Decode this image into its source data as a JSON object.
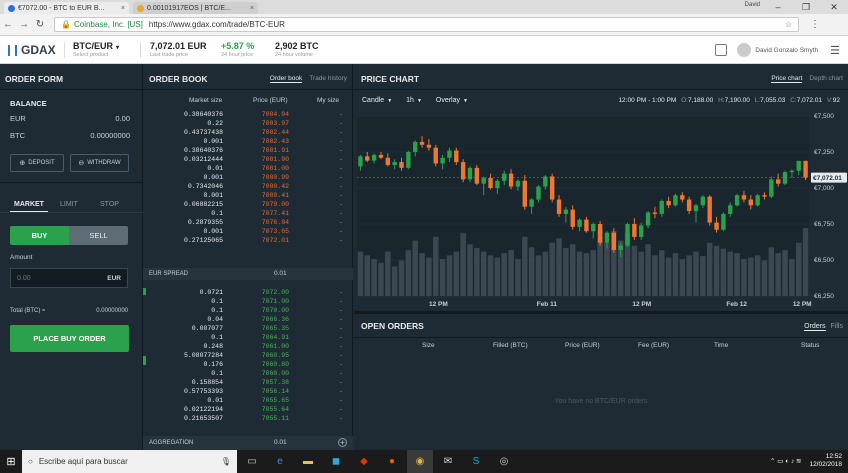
{
  "browser": {
    "tabs": [
      {
        "label": "€7072.00 - BTC to EUR B...",
        "active": true
      },
      {
        "label": "0.00101917EOS | BTC/E...",
        "active": false
      }
    ],
    "user_chip": "David",
    "controls": [
      "–",
      "❐",
      "✕"
    ],
    "secure_label": "Coinbase, Inc. [US]",
    "url": "https://www.gdax.com/trade/BTC-EUR"
  },
  "header": {
    "logo": "GDAX",
    "product": {
      "value": "BTC/EUR",
      "caption": "Select product"
    },
    "last_price": {
      "value": "7,072.01 EUR",
      "caption": "Last trade price"
    },
    "change": {
      "value": "+5.87 %",
      "caption": "24 hour price"
    },
    "volume": {
      "value": "2,902 BTC",
      "caption": "24 hour volume"
    },
    "user_name": "David Gonzalo Smyth"
  },
  "order_form": {
    "title": "ORDER FORM",
    "balance_title": "BALANCE",
    "balances": [
      {
        "currency": "EUR",
        "amount": "0.00"
      },
      {
        "currency": "BTC",
        "amount": "0.00000000"
      }
    ],
    "deposit_label": "DEPOSIT",
    "withdraw_label": "WITHDRAW",
    "tabs": [
      "MARKET",
      "LIMIT",
      "STOP"
    ],
    "buy_label": "BUY",
    "sell_label": "SELL",
    "amount_label": "Amount",
    "amount_placeholder": "0.00",
    "amount_currency": "EUR",
    "total_label": "Total (BTC) ≈",
    "total_value": "0.00000000",
    "place_label": "PLACE BUY ORDER"
  },
  "order_book": {
    "title": "ORDER BOOK",
    "tabs": [
      "Order book",
      "Trade history"
    ],
    "columns": [
      "Market size",
      "Price (EUR)",
      "My size"
    ],
    "asks": [
      {
        "size": "0.38640376",
        "price": "7084.04",
        "my": "-"
      },
      {
        "size": "0.22",
        "price": "7083.97",
        "my": "-"
      },
      {
        "size": "0.43737438",
        "price": "7082.44",
        "my": "-"
      },
      {
        "size": "0.001",
        "price": "7082.43",
        "my": "-"
      },
      {
        "size": "0.38640376",
        "price": "7081.91",
        "my": "-"
      },
      {
        "size": "0.03212444",
        "price": "7081.90",
        "my": "-"
      },
      {
        "size": "0.01",
        "price": "7081.00",
        "my": "-"
      },
      {
        "size": "0.001",
        "price": "7080.99",
        "my": "-"
      },
      {
        "size": "0.7342046",
        "price": "7080.42",
        "my": "-"
      },
      {
        "size": "0.001",
        "price": "7080.41",
        "my": "-"
      },
      {
        "size": "0.06882215",
        "price": "7079.00",
        "my": "-"
      },
      {
        "size": "0.1",
        "price": "7077.41",
        "my": "-"
      },
      {
        "size": "0.2879355",
        "price": "7076.84",
        "my": "-"
      },
      {
        "size": "0.001",
        "price": "7073.65",
        "my": "-"
      },
      {
        "size": "0.27125065",
        "price": "7072.01",
        "my": "-"
      }
    ],
    "spread_label": "EUR SPREAD",
    "spread_value": "0.01",
    "bids": [
      {
        "size": "0.0721",
        "price": "7072.00",
        "my": "-"
      },
      {
        "size": "0.1",
        "price": "7071.00",
        "my": "-"
      },
      {
        "size": "0.1",
        "price": "7070.00",
        "my": "-"
      },
      {
        "size": "0.04",
        "price": "7066.36",
        "my": "-"
      },
      {
        "size": "0.007077",
        "price": "7065.35",
        "my": "-"
      },
      {
        "size": "0.1",
        "price": "7064.91",
        "my": "-"
      },
      {
        "size": "0.248",
        "price": "7061.00",
        "my": "-"
      },
      {
        "size": "5.08077284",
        "price": "7060.95",
        "my": "-"
      },
      {
        "size": "0.176",
        "price": "7060.80",
        "my": "-"
      },
      {
        "size": "0.1",
        "price": "7060.00",
        "my": "-"
      },
      {
        "size": "0.158854",
        "price": "7057.38",
        "my": "-"
      },
      {
        "size": "0.57753393",
        "price": "7056.14",
        "my": "-"
      },
      {
        "size": "0.01",
        "price": "7055.65",
        "my": "-"
      },
      {
        "size": "0.02122194",
        "price": "7055.64",
        "my": "-"
      },
      {
        "size": "0.21653507",
        "price": "7055.11",
        "my": "-"
      }
    ],
    "aggregation_label": "AGGREGATION",
    "aggregation_value": "0.01"
  },
  "price_chart": {
    "title": "PRICE CHART",
    "tabs": [
      "Price chart",
      "Depth chart"
    ],
    "tools": [
      "Candle",
      "1h",
      "Overlay"
    ],
    "range": "12:00 PM - 1:00 PM",
    "ohlc": [
      {
        "k": "O:",
        "v": "7,188.00"
      },
      {
        "k": "H:",
        "v": "7,190.00"
      },
      {
        "k": "L:",
        "v": "7,055.03"
      },
      {
        "k": "C:",
        "v": "7,072.01"
      },
      {
        "k": "V:",
        "v": "92"
      }
    ],
    "colors": {
      "up": "#2aa14a",
      "down": "#f0772f",
      "volume": "#3b4852",
      "bg": "#1e2b34",
      "grid": "#2a3842"
    }
  },
  "chart_data": {
    "type": "candlestick",
    "title": "",
    "x_ticks": [
      "12 PM",
      "Feb 11",
      "12 PM",
      "Feb 12",
      "12 PM"
    ],
    "y_ticks": [
      "€7,500",
      "€7,250",
      "€7,000",
      "€6,750",
      "€6,500",
      "€6,250"
    ],
    "ylim": [
      6250,
      7500
    ],
    "current_price_label": "€7,072.01",
    "grid": true,
    "candles": [
      [
        7150,
        7230,
        7120,
        7220,
        60
      ],
      [
        7220,
        7250,
        7180,
        7190,
        55
      ],
      [
        7190,
        7240,
        7170,
        7230,
        50
      ],
      [
        7230,
        7250,
        7200,
        7210,
        45
      ],
      [
        7210,
        7240,
        7150,
        7160,
        60
      ],
      [
        7160,
        7200,
        7130,
        7180,
        40
      ],
      [
        7180,
        7210,
        7120,
        7140,
        48
      ],
      [
        7140,
        7260,
        7130,
        7250,
        62
      ],
      [
        7250,
        7330,
        7220,
        7320,
        75
      ],
      [
        7320,
        7360,
        7280,
        7300,
        58
      ],
      [
        7300,
        7340,
        7260,
        7280,
        52
      ],
      [
        7280,
        7300,
        7150,
        7170,
        80
      ],
      [
        7170,
        7230,
        7130,
        7210,
        50
      ],
      [
        7210,
        7280,
        7180,
        7260,
        55
      ],
      [
        7260,
        7280,
        7160,
        7180,
        60
      ],
      [
        7180,
        7200,
        7040,
        7060,
        85
      ],
      [
        7060,
        7150,
        7040,
        7140,
        70
      ],
      [
        7140,
        7160,
        7020,
        7030,
        65
      ],
      [
        7030,
        7080,
        6950,
        7070,
        60
      ],
      [
        7070,
        7100,
        6990,
        7000,
        55
      ],
      [
        7000,
        7060,
        6960,
        7050,
        52
      ],
      [
        7050,
        7120,
        7020,
        7100,
        58
      ],
      [
        7100,
        7130,
        6990,
        7010,
        62
      ],
      [
        7010,
        7060,
        6980,
        7050,
        50
      ],
      [
        7050,
        7090,
        6850,
        6870,
        80
      ],
      [
        6870,
        6930,
        6820,
        6920,
        66
      ],
      [
        6920,
        7020,
        6900,
        7010,
        55
      ],
      [
        7010,
        7090,
        6990,
        7080,
        60
      ],
      [
        7080,
        7100,
        6900,
        6920,
        72
      ],
      [
        6920,
        6950,
        6800,
        6820,
        78
      ],
      [
        6820,
        6870,
        6760,
        6850,
        65
      ],
      [
        6850,
        6880,
        6710,
        6730,
        70
      ],
      [
        6730,
        6790,
        6700,
        6780,
        60
      ],
      [
        6780,
        6800,
        6690,
        6700,
        58
      ],
      [
        6700,
        6760,
        6650,
        6750,
        62
      ],
      [
        6750,
        6770,
        6600,
        6620,
        90
      ],
      [
        6620,
        6700,
        6580,
        6690,
        72
      ],
      [
        6690,
        6720,
        6550,
        6570,
        88
      ],
      [
        6570,
        6620,
        6520,
        6600,
        75
      ],
      [
        6600,
        6760,
        6590,
        6750,
        85
      ],
      [
        6750,
        6790,
        6640,
        6660,
        68
      ],
      [
        6660,
        6760,
        6640,
        6740,
        60
      ],
      [
        6740,
        6840,
        6720,
        6830,
        70
      ],
      [
        6830,
        6870,
        6790,
        6820,
        55
      ],
      [
        6820,
        6920,
        6800,
        6910,
        62
      ],
      [
        6910,
        6940,
        6860,
        6880,
        52
      ],
      [
        6880,
        6960,
        6870,
        6950,
        58
      ],
      [
        6950,
        6970,
        6900,
        6920,
        50
      ],
      [
        6920,
        6940,
        6820,
        6840,
        55
      ],
      [
        6840,
        6890,
        6760,
        6880,
        60
      ],
      [
        6880,
        6950,
        6860,
        6940,
        54
      ],
      [
        6940,
        6950,
        6740,
        6760,
        72
      ],
      [
        6760,
        6800,
        6690,
        6710,
        68
      ],
      [
        6710,
        6830,
        6700,
        6820,
        64
      ],
      [
        6820,
        6900,
        6800,
        6880,
        60
      ],
      [
        6880,
        6960,
        6870,
        6950,
        58
      ],
      [
        6950,
        6980,
        6900,
        6920,
        50
      ],
      [
        6920,
        6950,
        6850,
        6880,
        52
      ],
      [
        6880,
        6960,
        6870,
        6950,
        55
      ],
      [
        6950,
        6970,
        6920,
        6940,
        48
      ],
      [
        6940,
        7080,
        6930,
        7060,
        66
      ],
      [
        7060,
        7100,
        7010,
        7030,
        58
      ],
      [
        7030,
        7120,
        7020,
        7110,
        62
      ],
      [
        7110,
        7130,
        7070,
        7120,
        50
      ],
      [
        7120,
        7190,
        7090,
        7188,
        72
      ],
      [
        7188,
        7190,
        7055,
        7072,
        92
      ]
    ]
  },
  "open_orders": {
    "title": "OPEN ORDERS",
    "tabs": [
      "Orders",
      "Fills"
    ],
    "columns": [
      "Size",
      "Filled (BTC)",
      "Price (EUR)",
      "Fee (EUR)",
      "Time",
      "Status"
    ],
    "empty_text": "You have no BTC/EUR orders"
  },
  "taskbar": {
    "search_placeholder": "Escribe aquí para buscar",
    "time": "12:52",
    "date": "12/02/2018"
  }
}
